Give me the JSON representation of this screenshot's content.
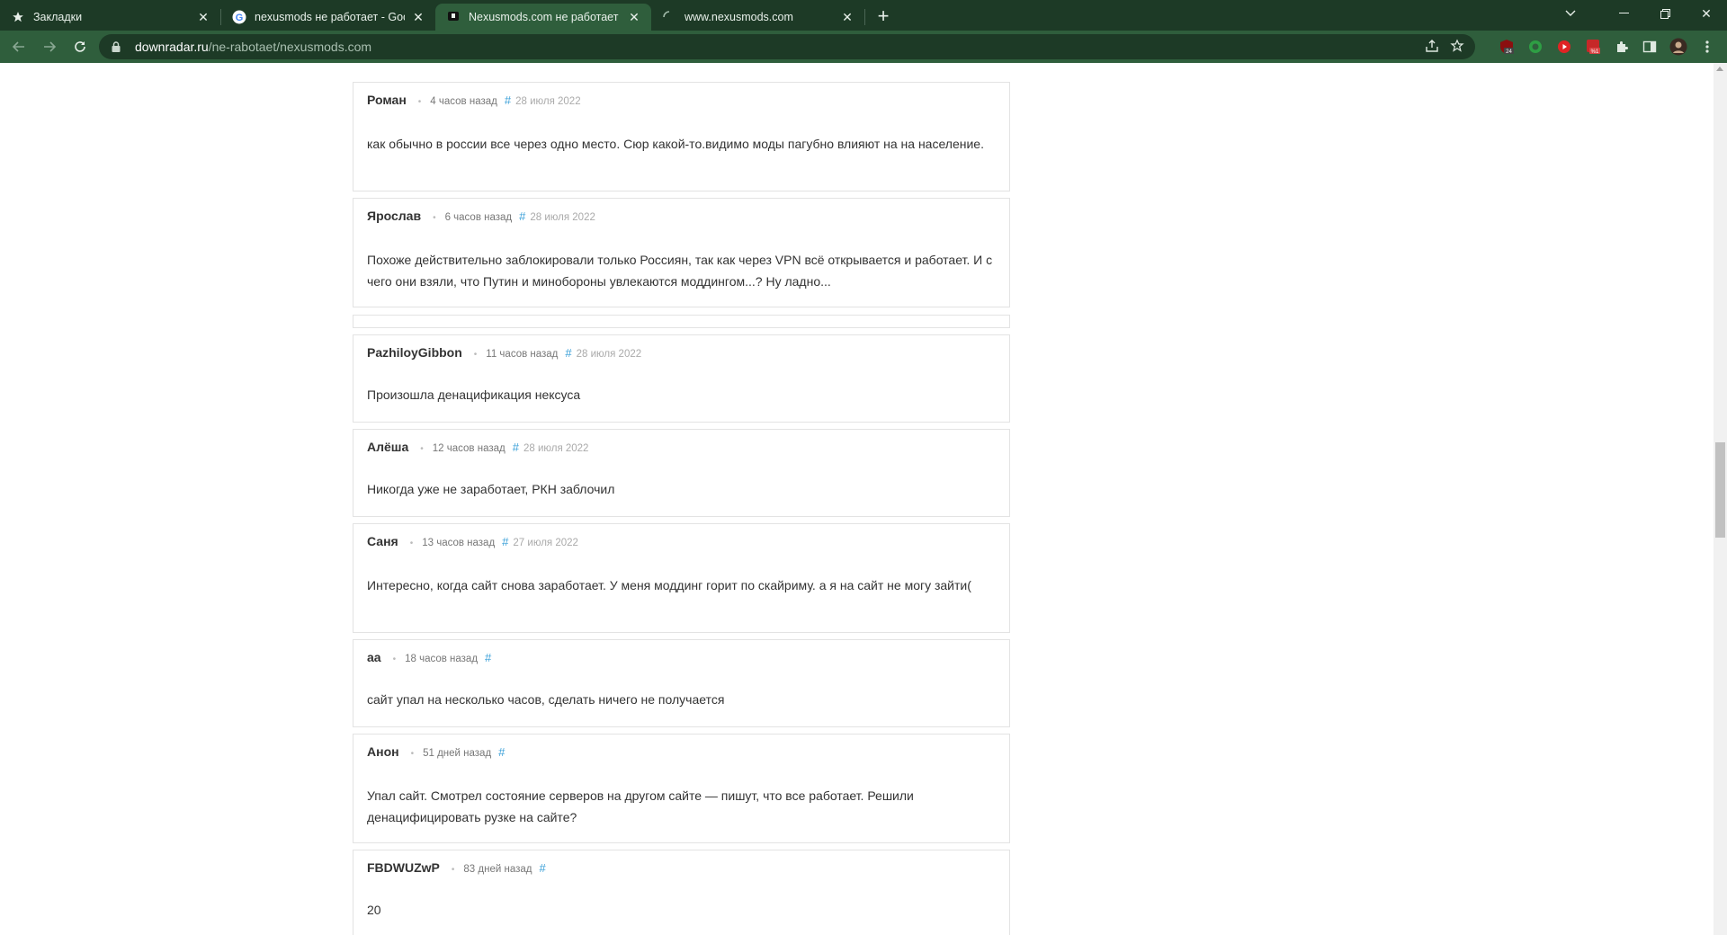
{
  "browser": {
    "tabs": [
      {
        "title": "Закладки",
        "icon": "star-icon",
        "active": false
      },
      {
        "title": "nexusmods не работает - Googl",
        "icon": "google-icon",
        "active": false
      },
      {
        "title": "Nexusmods.com не работает се",
        "icon": "site-favicon",
        "active": true
      },
      {
        "title": "www.nexusmods.com",
        "icon": "loading-spinner-icon",
        "active": false
      }
    ],
    "url_host": "downradar.ru",
    "url_path": "/ne-rabotaet/nexusmods.com",
    "colors": {
      "frame": "#1d3a26",
      "toolbar": "#2f5e3c",
      "link": "#3aa0d8"
    }
  },
  "comments": [
    {
      "author": "Роман",
      "ago": "4 часов назад",
      "hash": "#",
      "date": "28 июля 2022",
      "text": "как обычно в россии все через одно место. Сюр какой-то.видимо моды пагубно влияют на на население."
    },
    {
      "author": "Ярослав",
      "ago": "6 часов назад",
      "hash": "#",
      "date": "28 июля 2022",
      "text": "Похоже действительно заблокировали только Россиян, так как через VPN всё открывается и работает. И с чего они взяли, что Путин и минобороны увлекаются моддингом...? Ну ладно..."
    },
    {
      "author": "PazhiloyGibbon",
      "ago": "11 часов назад",
      "hash": "#",
      "date": "28 июля 2022",
      "text": "Произошла денацификация нексуса"
    },
    {
      "author": "Алёша",
      "ago": "12 часов назад",
      "hash": "#",
      "date": "28 июля 2022",
      "text": "Никогда уже не заработает, РКН заблочил"
    },
    {
      "author": "Саня",
      "ago": "13 часов назад",
      "hash": "#",
      "date": "27 июля 2022",
      "text": "Интересно, когда сайт снова заработает. У меня моддинг горит по скайриму. а я на сайт не могу зайти("
    },
    {
      "author": "аа",
      "ago": "18 часов назад",
      "hash": "#",
      "date": "",
      "text": "сайт упал на несколько часов, сделать ничего не получается"
    },
    {
      "author": "Анон",
      "ago": "51 дней назад",
      "hash": "#",
      "date": "",
      "text": "Упал сайт. Смотрел состояние серверов на другом сайте — пишут, что все работает. Решили денацифицировать рузке на сайте?"
    },
    {
      "author": "FBDWUZwP",
      "ago": "83 дней назад",
      "hash": "#",
      "date": "",
      "text": "20"
    }
  ]
}
